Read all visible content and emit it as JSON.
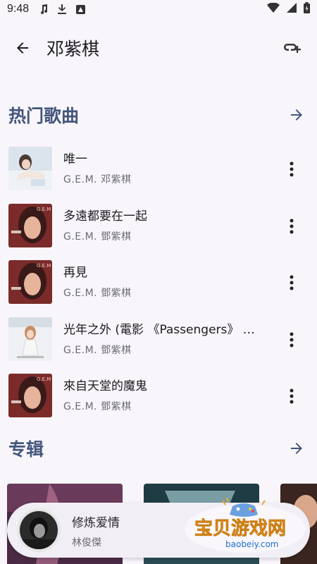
{
  "status_bar": {
    "time": "9:48"
  },
  "app_bar": {
    "title": "邓紫棋"
  },
  "hot_songs": {
    "title": "热门歌曲",
    "songs": [
      {
        "title": "唯一",
        "artist": "G.E.M. 邓紫棋"
      },
      {
        "title": "多遠都要在一起",
        "artist": "G.E.M. 鄧紫棋"
      },
      {
        "title": "再見",
        "artist": "G.E.M. 鄧紫棋"
      },
      {
        "title": "光年之外 (電影 《Passengers》 …",
        "artist": "G.E.M. 鄧紫棋"
      },
      {
        "title": "來自天堂的魔鬼",
        "artist": "G.E.M. 鄧紫棋"
      }
    ]
  },
  "albums": {
    "title": "专辑"
  },
  "mini_player": {
    "title": "修炼爱情",
    "artist": "林俊傑"
  },
  "watermark": {
    "text": "宝贝游戏网",
    "url": "baobeiy.com"
  },
  "colors": {
    "section_title": "#44567d",
    "background": "#f8f6fb",
    "player_bg": "#f1eef5"
  }
}
